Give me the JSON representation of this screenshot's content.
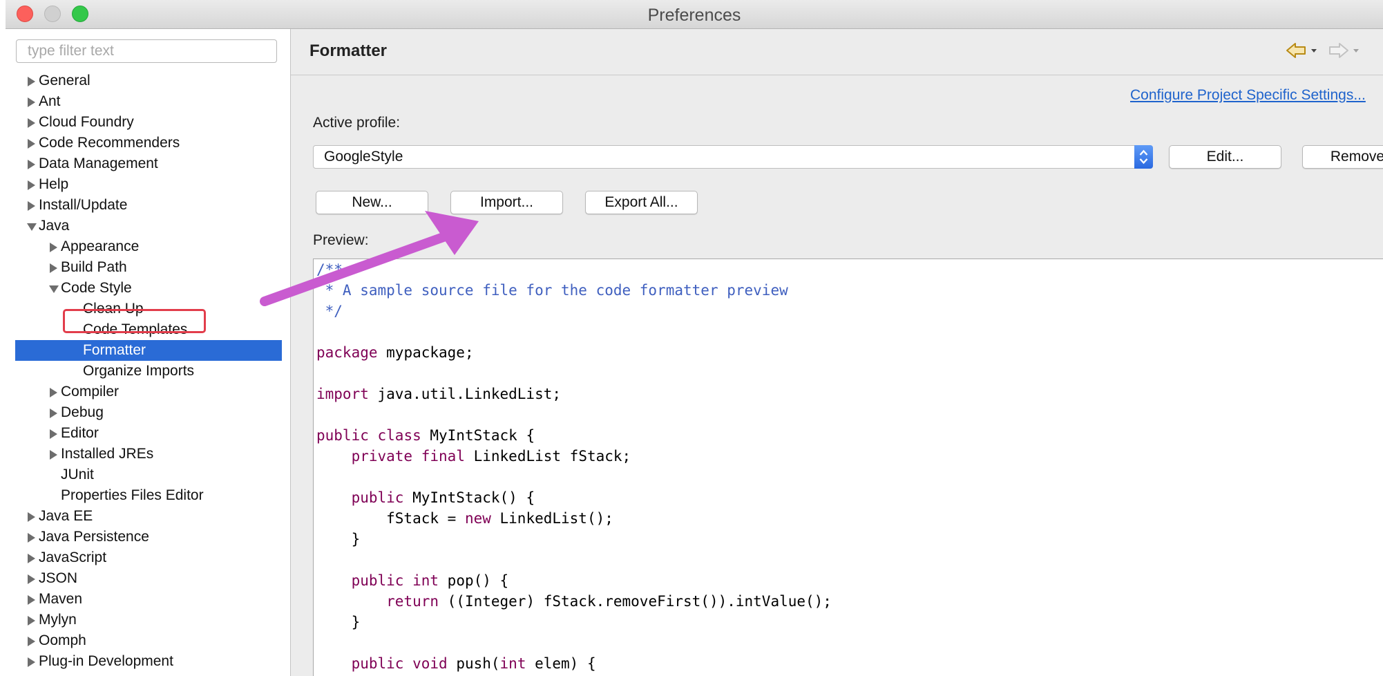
{
  "window": {
    "title": "Preferences"
  },
  "sidebar": {
    "filter_placeholder": "type filter text",
    "items": [
      {
        "label": "General",
        "depth": 0,
        "expander": "closed"
      },
      {
        "label": "Ant",
        "depth": 0,
        "expander": "closed"
      },
      {
        "label": "Cloud Foundry",
        "depth": 0,
        "expander": "closed"
      },
      {
        "label": "Code Recommenders",
        "depth": 0,
        "expander": "closed"
      },
      {
        "label": "Data Management",
        "depth": 0,
        "expander": "closed"
      },
      {
        "label": "Help",
        "depth": 0,
        "expander": "closed"
      },
      {
        "label": "Install/Update",
        "depth": 0,
        "expander": "closed"
      },
      {
        "label": "Java",
        "depth": 0,
        "expander": "open"
      },
      {
        "label": "Appearance",
        "depth": 1,
        "expander": "closed"
      },
      {
        "label": "Build Path",
        "depth": 1,
        "expander": "closed"
      },
      {
        "label": "Code Style",
        "depth": 1,
        "expander": "open"
      },
      {
        "label": "Clean Up",
        "depth": 2,
        "expander": "none"
      },
      {
        "label": "Code Templates",
        "depth": 2,
        "expander": "none"
      },
      {
        "label": "Formatter",
        "depth": 2,
        "expander": "none",
        "selected": true
      },
      {
        "label": "Organize Imports",
        "depth": 2,
        "expander": "none"
      },
      {
        "label": "Compiler",
        "depth": 1,
        "expander": "closed"
      },
      {
        "label": "Debug",
        "depth": 1,
        "expander": "closed"
      },
      {
        "label": "Editor",
        "depth": 1,
        "expander": "closed"
      },
      {
        "label": "Installed JREs",
        "depth": 1,
        "expander": "closed"
      },
      {
        "label": "JUnit",
        "depth": 1,
        "expander": "none"
      },
      {
        "label": "Properties Files Editor",
        "depth": 1,
        "expander": "none"
      },
      {
        "label": "Java EE",
        "depth": 0,
        "expander": "closed"
      },
      {
        "label": "Java Persistence",
        "depth": 0,
        "expander": "closed"
      },
      {
        "label": "JavaScript",
        "depth": 0,
        "expander": "closed"
      },
      {
        "label": "JSON",
        "depth": 0,
        "expander": "closed"
      },
      {
        "label": "Maven",
        "depth": 0,
        "expander": "closed"
      },
      {
        "label": "Mylyn",
        "depth": 0,
        "expander": "closed"
      },
      {
        "label": "Oomph",
        "depth": 0,
        "expander": "closed"
      },
      {
        "label": "Plug-in Development",
        "depth": 0,
        "expander": "closed"
      }
    ]
  },
  "page": {
    "title": "Formatter",
    "configure_link": "Configure Project Specific Settings...",
    "active_profile_label": "Active profile:",
    "active_profile_value": "GoogleStyle",
    "edit_button": "Edit...",
    "remove_button": "Remove",
    "new_button": "New...",
    "import_button": "Import...",
    "export_button": "Export All...",
    "preview_label": "Preview:"
  },
  "colors": {
    "comment": "#3f5fbf",
    "keyword": "#7f0055",
    "text": "#000000",
    "selection": "#2a6bd6",
    "highlight_box": "#e23d4b",
    "annotation_arrow": "#c95bd0"
  },
  "preview": {
    "lines": [
      [
        {
          "t": "/**",
          "c": "comment"
        }
      ],
      [
        {
          "t": " * A sample source file for the code formatter preview",
          "c": "comment"
        }
      ],
      [
        {
          "t": " */",
          "c": "comment"
        }
      ],
      [],
      [
        {
          "t": "package",
          "c": "keyword"
        },
        {
          "t": " mypackage;",
          "c": "text"
        }
      ],
      [],
      [
        {
          "t": "import",
          "c": "keyword"
        },
        {
          "t": " java.util.LinkedList;",
          "c": "text"
        }
      ],
      [],
      [
        {
          "t": "public",
          "c": "keyword"
        },
        {
          "t": " ",
          "c": "text"
        },
        {
          "t": "class",
          "c": "keyword"
        },
        {
          "t": " MyIntStack {",
          "c": "text"
        }
      ],
      [
        {
          "t": "    ",
          "c": "text"
        },
        {
          "t": "private",
          "c": "keyword"
        },
        {
          "t": " ",
          "c": "text"
        },
        {
          "t": "final",
          "c": "keyword"
        },
        {
          "t": " LinkedList fStack;",
          "c": "text"
        }
      ],
      [],
      [
        {
          "t": "    ",
          "c": "text"
        },
        {
          "t": "public",
          "c": "keyword"
        },
        {
          "t": " MyIntStack() {",
          "c": "text"
        }
      ],
      [
        {
          "t": "        fStack = ",
          "c": "text"
        },
        {
          "t": "new",
          "c": "keyword"
        },
        {
          "t": " LinkedList();",
          "c": "text"
        }
      ],
      [
        {
          "t": "    }",
          "c": "text"
        }
      ],
      [],
      [
        {
          "t": "    ",
          "c": "text"
        },
        {
          "t": "public",
          "c": "keyword"
        },
        {
          "t": " ",
          "c": "text"
        },
        {
          "t": "int",
          "c": "keyword"
        },
        {
          "t": " pop() {",
          "c": "text"
        }
      ],
      [
        {
          "t": "        ",
          "c": "text"
        },
        {
          "t": "return",
          "c": "keyword"
        },
        {
          "t": " ((Integer) fStack.removeFirst()).intValue();",
          "c": "text"
        }
      ],
      [
        {
          "t": "    }",
          "c": "text"
        }
      ],
      [],
      [
        {
          "t": "    ",
          "c": "text"
        },
        {
          "t": "public",
          "c": "keyword"
        },
        {
          "t": " ",
          "c": "text"
        },
        {
          "t": "void",
          "c": "keyword"
        },
        {
          "t": " push(",
          "c": "text"
        },
        {
          "t": "int",
          "c": "keyword"
        },
        {
          "t": " elem) {",
          "c": "text"
        }
      ]
    ]
  }
}
